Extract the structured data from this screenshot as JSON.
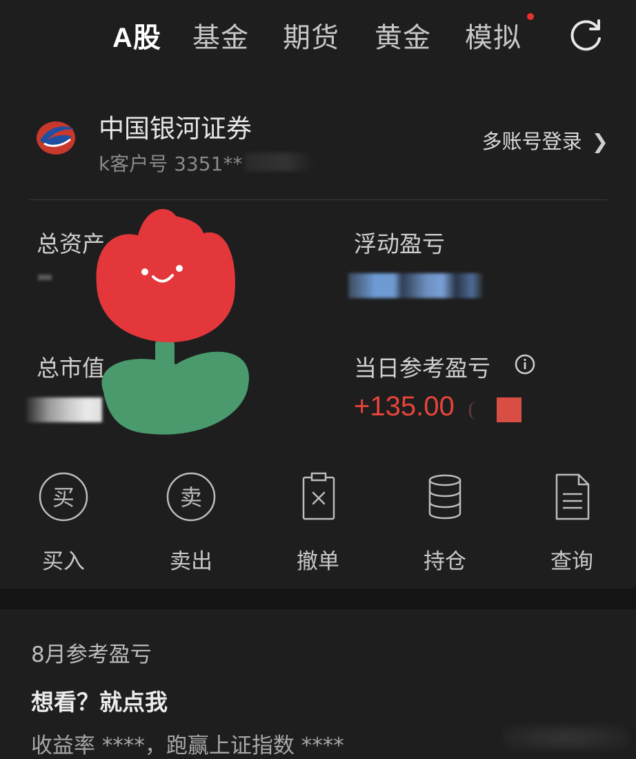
{
  "tabs": [
    {
      "label": "A股",
      "active": true
    },
    {
      "label": "基金",
      "active": false
    },
    {
      "label": "期货",
      "active": false
    },
    {
      "label": "黄金",
      "active": false
    },
    {
      "label": "模拟",
      "active": false,
      "badge": true
    }
  ],
  "account": {
    "broker_name": "中国银河证券",
    "account_no": "k客户号 3351**",
    "multi_login": "多账号登录"
  },
  "stats": {
    "total_assets_label": "总资产",
    "floating_pnl_label": "浮动盈亏",
    "market_value_label": "总市值",
    "daily_pnl_label": "当日参考盈亏",
    "daily_pnl_value": "+135.00"
  },
  "actions": [
    {
      "label": "买入",
      "icon": "buy-icon",
      "glyph": "买"
    },
    {
      "label": "卖出",
      "icon": "sell-icon",
      "glyph": "卖"
    },
    {
      "label": "撤单",
      "icon": "cancel-order-icon"
    },
    {
      "label": "持仓",
      "icon": "holdings-icon"
    },
    {
      "label": "查询",
      "icon": "query-document-icon"
    }
  ],
  "monthly": {
    "title": "8月参考盈亏",
    "cta": "想看？就点我",
    "subtitle": "收益率 ****，跑赢上证指数 ****"
  },
  "colors": {
    "background": "#1e1e1e",
    "profit_red": "#e8443a",
    "badge_red": "#e8302c"
  }
}
